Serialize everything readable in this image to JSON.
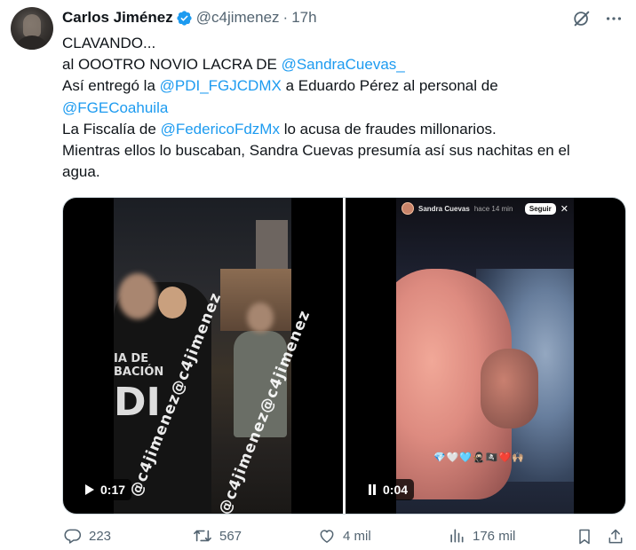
{
  "author": {
    "name": "Carlos Jiménez",
    "handle": "@c4jimenez",
    "separator": "·",
    "time": "17h",
    "verified_color": "#1d9bf0"
  },
  "tweet": {
    "lines": [
      [
        {
          "t": "CLAVANDO...",
          "m": false
        }
      ],
      [
        {
          "t": "al OOOTRO NOVIO LACRA DE ",
          "m": false
        },
        {
          "t": "@SandraCuevas_",
          "m": true
        }
      ],
      [
        {
          "t": "Así entregó la ",
          "m": false
        },
        {
          "t": "@PDI_FGJCDMX",
          "m": true
        },
        {
          "t": " a Eduardo Pérez al personal de",
          "m": false
        }
      ],
      [
        {
          "t": "@FGECoahuila",
          "m": true
        }
      ],
      [
        {
          "t": "La Fiscalía de ",
          "m": false
        },
        {
          "t": "@FedericoFdzMx",
          "m": true
        },
        {
          "t": " lo acusa de fraudes millonarios.",
          "m": false
        }
      ],
      [
        {
          "t": "Mientras ellos lo buscaban, Sandra Cuevas presumía así sus nachitas en el",
          "m": false
        }
      ],
      [
        {
          "t": "agua.",
          "m": false
        }
      ]
    ]
  },
  "videos": [
    {
      "duration": "0:17",
      "state": "paused",
      "watermark": "@c4jimenez@c4jimenez",
      "patch_line1": "IA DE",
      "patch_line2": "BACIÓN",
      "patch_line3": "DI"
    },
    {
      "duration": "0:04",
      "state": "playing",
      "story_user": "Sandra Cuevas",
      "story_time": "hace 14 min",
      "follow_label": "Seguir",
      "close_glyph": "✕",
      "emojis": "💎🤍🩵🥷🏻🏴‍☠️❤️🙌🏼"
    }
  ],
  "actions": {
    "replies": "223",
    "reposts": "567",
    "likes": "4 mil",
    "views": "176 mil"
  },
  "colors": {
    "text": "#0f1419",
    "secondary": "#536471",
    "link": "#1d9bf0",
    "border": "#cfd9de"
  }
}
